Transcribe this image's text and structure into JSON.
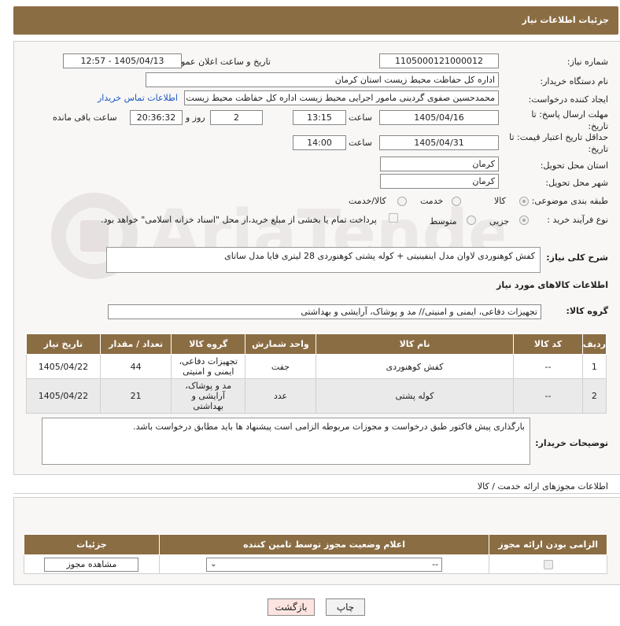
{
  "header": {
    "title": "جزئیات اطلاعات نیاز"
  },
  "need": {
    "number_label": "شماره نیاز:",
    "number": "1105000121000012",
    "announce_label": "تاریخ و ساعت اعلان عمومی:",
    "announce_value": "1405/04/13 - 12:57",
    "buyer_label": "نام دستگاه خریدار:",
    "buyer": "اداره کل حفاظت محیط زیست استان کرمان",
    "creator_label": "ایجاد کننده درخواست:",
    "creator": "محمدحسین صفوی گردینی مامور اجرایی محیط زیست اداره کل حفاظت محیط زیست",
    "contact_link": "اطلاعات تماس خریدار",
    "deadline_label": "مهلت ارسال پاسخ: تا تاریخ:",
    "deadline_date": "1405/04/16",
    "time_label": "ساعت",
    "deadline_time": "13:15",
    "days": "2",
    "days_label": "روز و",
    "remaining": "20:36:32",
    "remaining_label": "ساعت باقی مانده",
    "price_label": "حداقل تاریخ اعتبار قیمت: تا تاریخ:",
    "price_date": "1405/04/31",
    "price_time": "14:00",
    "province_label": "استان محل تحویل:",
    "province": "کرمان",
    "city_label": "شهر محل تحویل:",
    "city": "کرمان",
    "category_label": "طبقه بندی موضوعی:",
    "category_options": [
      "کالا",
      "خدمت",
      "کالا/خدمت"
    ],
    "purchase_label": "نوع فرآیند خرید :",
    "purchase_options": [
      "جزیی",
      "متوسط"
    ],
    "payment_note": "پرداخت تمام یا بخشی از مبلغ خرید،از محل \"اسناد خزانه اسلامی\" خواهد بود."
  },
  "summary": {
    "label": "شرح کلی نیاز:",
    "text": "کفش کوهنوردی لاوان مدل اینفینیتی + کوله پشتی کوهنوردی 28 لیتری فایا مدل ساتای"
  },
  "goods": {
    "section_title": "اطلاعات کالاهای مورد نیاز",
    "group_label": "گروه کالا:",
    "group_value": "تجهیزات دفاعی، ایمنی و امنیتی// مد و پوشاک، آرایشی و بهداشتی",
    "columns": [
      "ردیف",
      "کد کالا",
      "نام کالا",
      "واحد شمارش",
      "گروه کالا",
      "تعداد / مقدار",
      "تاریخ نیاز"
    ],
    "rows": [
      {
        "row": "1",
        "code": "--",
        "name": "کفش کوهنوردی",
        "unit": "جفت",
        "group": "تجهیزات دفاعی، ایمنی و امنیتی",
        "qty": "44",
        "date": "1405/04/22"
      },
      {
        "row": "2",
        "code": "--",
        "name": "کوله پشتی",
        "unit": "عدد",
        "group": "مد و پوشاک، آرایشی و بهداشتی",
        "qty": "21",
        "date": "1405/04/22"
      }
    ]
  },
  "buyer_notes": {
    "label": "توضیحات خریدار:",
    "text": "بارگذاری پیش فاکتور طبق درخواست و مجوزات مربوطه الزامی است پیشنهاد ها باید مطابق درخواست باشد."
  },
  "permits": {
    "title": "اطلاعات مجوزهای ارائه خدمت / کالا",
    "columns": [
      "الزامی بودن ارائه مجوز",
      "اعلام وضعیت مجوز توسط تامین کننده",
      "جزئیات"
    ],
    "select_value": "--",
    "view_button": "مشاهده مجوز"
  },
  "actions": {
    "print": "چاپ",
    "back": "بازگشت"
  },
  "colors": {
    "header": "#8b6d44",
    "link": "#1a56c5"
  }
}
